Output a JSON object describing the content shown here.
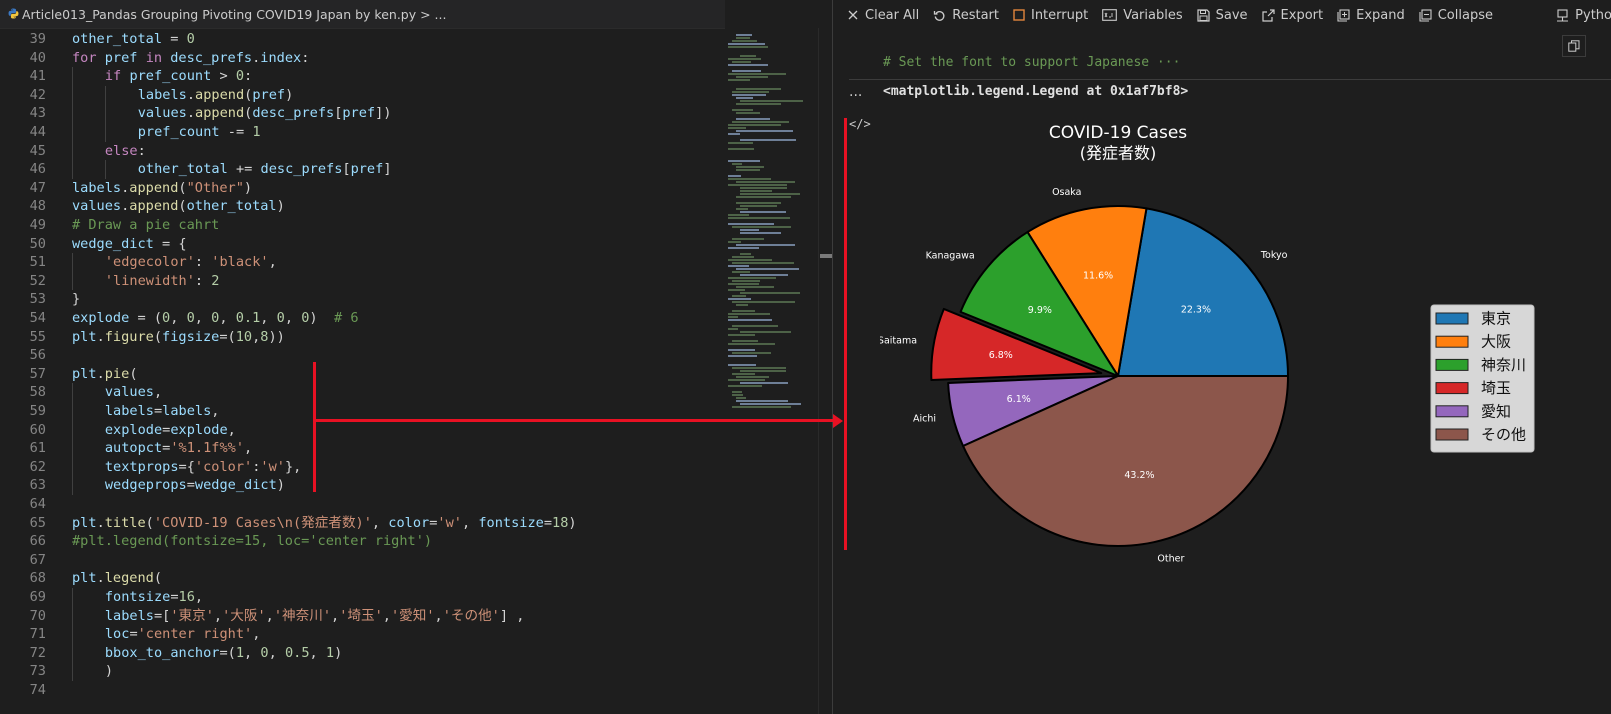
{
  "editor": {
    "tab_title": "Article013_Pandas Grouping Pivoting COVID19 Japan by ken.py > ...",
    "lines": [
      {
        "n": "39",
        "t": [
          [
            "vr",
            "other_total"
          ],
          [
            "op",
            " = "
          ],
          [
            "num",
            "0"
          ]
        ]
      },
      {
        "n": "40",
        "t": [
          [
            "kw",
            "for"
          ],
          [
            "op",
            " "
          ],
          [
            "vr",
            "pref"
          ],
          [
            "op",
            " "
          ],
          [
            "kw",
            "in"
          ],
          [
            "op",
            " "
          ],
          [
            "vr",
            "desc_prefs"
          ],
          [
            "op",
            "."
          ],
          [
            "vr",
            "index"
          ],
          [
            "op",
            ":"
          ]
        ]
      },
      {
        "n": "41",
        "i": 1,
        "t": [
          [
            "kw",
            "if"
          ],
          [
            "op",
            " "
          ],
          [
            "vr",
            "pref_count"
          ],
          [
            "op",
            " > "
          ],
          [
            "num",
            "0"
          ],
          [
            "op",
            ":"
          ]
        ]
      },
      {
        "n": "42",
        "i": 2,
        "t": [
          [
            "vr",
            "labels"
          ],
          [
            "op",
            "."
          ],
          [
            "fn",
            "append"
          ],
          [
            "op",
            "("
          ],
          [
            "vr",
            "pref"
          ],
          [
            "op",
            ")"
          ]
        ]
      },
      {
        "n": "43",
        "i": 2,
        "t": [
          [
            "vr",
            "values"
          ],
          [
            "op",
            "."
          ],
          [
            "fn",
            "append"
          ],
          [
            "op",
            "("
          ],
          [
            "vr",
            "desc_prefs"
          ],
          [
            "op",
            "["
          ],
          [
            "vr",
            "pref"
          ],
          [
            "op",
            "])"
          ]
        ]
      },
      {
        "n": "44",
        "i": 2,
        "t": [
          [
            "vr",
            "pref_count"
          ],
          [
            "op",
            " -= "
          ],
          [
            "num",
            "1"
          ]
        ]
      },
      {
        "n": "45",
        "i": 1,
        "t": [
          [
            "kw",
            "else"
          ],
          [
            "op",
            ":"
          ]
        ]
      },
      {
        "n": "46",
        "i": 2,
        "t": [
          [
            "vr",
            "other_total"
          ],
          [
            "op",
            " += "
          ],
          [
            "vr",
            "desc_prefs"
          ],
          [
            "op",
            "["
          ],
          [
            "vr",
            "pref"
          ],
          [
            "op",
            "]"
          ]
        ]
      },
      {
        "n": "47",
        "t": [
          [
            "vr",
            "labels"
          ],
          [
            "op",
            "."
          ],
          [
            "fn",
            "append"
          ],
          [
            "op",
            "("
          ],
          [
            "str",
            "\"Other\""
          ],
          [
            "op",
            ")"
          ]
        ]
      },
      {
        "n": "48",
        "t": [
          [
            "vr",
            "values"
          ],
          [
            "op",
            "."
          ],
          [
            "fn",
            "append"
          ],
          [
            "op",
            "("
          ],
          [
            "vr",
            "other_total"
          ],
          [
            "op",
            ")"
          ]
        ]
      },
      {
        "n": "49",
        "t": [
          [
            "cm",
            "# Draw a pie cahrt"
          ]
        ]
      },
      {
        "n": "50",
        "t": [
          [
            "vr",
            "wedge_dict"
          ],
          [
            "op",
            " = {"
          ]
        ]
      },
      {
        "n": "51",
        "i": 1,
        "t": [
          [
            "str",
            "'edgecolor'"
          ],
          [
            "op",
            ": "
          ],
          [
            "str",
            "'black'"
          ],
          [
            "op",
            ","
          ]
        ]
      },
      {
        "n": "52",
        "i": 1,
        "t": [
          [
            "str",
            "'linewidth'"
          ],
          [
            "op",
            ": "
          ],
          [
            "num",
            "2"
          ]
        ]
      },
      {
        "n": "53",
        "t": [
          [
            "op",
            "}"
          ]
        ]
      },
      {
        "n": "54",
        "t": [
          [
            "vr",
            "explode"
          ],
          [
            "op",
            " = ("
          ],
          [
            "num",
            "0"
          ],
          [
            "op",
            ", "
          ],
          [
            "num",
            "0"
          ],
          [
            "op",
            ", "
          ],
          [
            "num",
            "0"
          ],
          [
            "op",
            ", "
          ],
          [
            "num",
            "0.1"
          ],
          [
            "op",
            ", "
          ],
          [
            "num",
            "0"
          ],
          [
            "op",
            ", "
          ],
          [
            "num",
            "0"
          ],
          [
            "op",
            ")  "
          ],
          [
            "cm",
            "# 6"
          ]
        ]
      },
      {
        "n": "55",
        "t": [
          [
            "vr",
            "plt"
          ],
          [
            "op",
            "."
          ],
          [
            "fn",
            "figure"
          ],
          [
            "op",
            "("
          ],
          [
            "vr",
            "figsize"
          ],
          [
            "op",
            "=("
          ],
          [
            "num",
            "10"
          ],
          [
            "op",
            ","
          ],
          [
            "num",
            "8"
          ],
          [
            "op",
            "))"
          ]
        ]
      },
      {
        "n": "56",
        "t": []
      },
      {
        "n": "57",
        "t": [
          [
            "vr",
            "plt"
          ],
          [
            "op",
            "."
          ],
          [
            "fn",
            "pie"
          ],
          [
            "op",
            "("
          ]
        ]
      },
      {
        "n": "58",
        "i": 1,
        "t": [
          [
            "vr",
            "values"
          ],
          [
            "op",
            ","
          ]
        ]
      },
      {
        "n": "59",
        "i": 1,
        "t": [
          [
            "vr",
            "labels"
          ],
          [
            "op",
            "="
          ],
          [
            "vr",
            "labels"
          ],
          [
            "op",
            ","
          ]
        ]
      },
      {
        "n": "60",
        "i": 1,
        "t": [
          [
            "vr",
            "explode"
          ],
          [
            "op",
            "="
          ],
          [
            "vr",
            "explode"
          ],
          [
            "op",
            ","
          ]
        ]
      },
      {
        "n": "61",
        "i": 1,
        "t": [
          [
            "vr",
            "autopct"
          ],
          [
            "op",
            "="
          ],
          [
            "str",
            "'%1.1f%%'"
          ],
          [
            "op",
            ","
          ]
        ]
      },
      {
        "n": "62",
        "i": 1,
        "t": [
          [
            "vr",
            "textprops"
          ],
          [
            "op",
            "={"
          ],
          [
            "str",
            "'color'"
          ],
          [
            "op",
            ":"
          ],
          [
            "str",
            "'w'"
          ],
          [
            "op",
            "},"
          ]
        ]
      },
      {
        "n": "63",
        "i": 1,
        "t": [
          [
            "vr",
            "wedgeprops"
          ],
          [
            "op",
            "="
          ],
          [
            "vr",
            "wedge_dict"
          ],
          [
            "op",
            ")"
          ]
        ]
      },
      {
        "n": "64",
        "t": []
      },
      {
        "n": "65",
        "t": [
          [
            "vr",
            "plt"
          ],
          [
            "op",
            "."
          ],
          [
            "fn",
            "title"
          ],
          [
            "op",
            "("
          ],
          [
            "str",
            "'COVID-19 Cases\\n(発症者数)'"
          ],
          [
            "op",
            ", "
          ],
          [
            "vr",
            "color"
          ],
          [
            "op",
            "="
          ],
          [
            "str",
            "'w'"
          ],
          [
            "op",
            ", "
          ],
          [
            "vr",
            "fontsize"
          ],
          [
            "op",
            "="
          ],
          [
            "num",
            "18"
          ],
          [
            "op",
            ")"
          ]
        ]
      },
      {
        "n": "66",
        "t": [
          [
            "cm",
            "#plt.legend(fontsize=15, loc='center right')"
          ]
        ]
      },
      {
        "n": "67",
        "t": []
      },
      {
        "n": "68",
        "t": [
          [
            "vr",
            "plt"
          ],
          [
            "op",
            "."
          ],
          [
            "fn",
            "legend"
          ],
          [
            "op",
            "("
          ]
        ]
      },
      {
        "n": "69",
        "i": 1,
        "t": [
          [
            "vr",
            "fontsize"
          ],
          [
            "op",
            "="
          ],
          [
            "num",
            "16"
          ],
          [
            "op",
            ","
          ]
        ]
      },
      {
        "n": "70",
        "i": 1,
        "t": [
          [
            "vr",
            "labels"
          ],
          [
            "op",
            "=["
          ],
          [
            "str",
            "'東京'"
          ],
          [
            "op",
            ","
          ],
          [
            "str",
            "'大阪'"
          ],
          [
            "op",
            ","
          ],
          [
            "str",
            "'神奈川'"
          ],
          [
            "op",
            ","
          ],
          [
            "str",
            "'埼玉'"
          ],
          [
            "op",
            ","
          ],
          [
            "str",
            "'愛知'"
          ],
          [
            "op",
            ","
          ],
          [
            "str",
            "'その他'"
          ],
          [
            "op",
            "] ,"
          ]
        ]
      },
      {
        "n": "71",
        "i": 1,
        "t": [
          [
            "vr",
            "loc"
          ],
          [
            "op",
            "="
          ],
          [
            "str",
            "'center right'"
          ],
          [
            "op",
            ","
          ]
        ]
      },
      {
        "n": "72",
        "i": 1,
        "t": [
          [
            "vr",
            "bbox_to_anchor"
          ],
          [
            "op",
            "=("
          ],
          [
            "num",
            "1"
          ],
          [
            "op",
            ", "
          ],
          [
            "num",
            "0"
          ],
          [
            "op",
            ", "
          ],
          [
            "num",
            "0.5"
          ],
          [
            "op",
            ", "
          ],
          [
            "num",
            "1"
          ],
          [
            "op",
            ")"
          ]
        ]
      },
      {
        "n": "73",
        "i": 1,
        "t": [
          [
            "op",
            ")"
          ]
        ]
      },
      {
        "n": "74",
        "t": []
      }
    ]
  },
  "toolbar": {
    "clear_all": "Clear All",
    "restart": "Restart",
    "interrupt": "Interrupt",
    "variables": "Variables",
    "save": "Save",
    "export": "Export",
    "expand": "Expand",
    "collapse": "Collapse",
    "python": "Pytho"
  },
  "cell": {
    "comment": "# Set the font to support Japanese ···",
    "ellipsis": "...",
    "output_text": "<matplotlib.legend.Legend at 0x1af7bf8>",
    "code_icon": "</>"
  },
  "colors": {
    "accent_red": "#e81123",
    "tokyo": "#1f77b4",
    "osaka": "#ff7f0e",
    "kanagawa": "#2ca02c",
    "saitama": "#d62728",
    "aichi": "#9467bd",
    "other": "#8c564b"
  },
  "chart_data": {
    "type": "pie",
    "title": "COVID-19 Cases",
    "subtitle": "(発症者数)",
    "categories": [
      "Tokyo",
      "Osaka",
      "Kanagawa",
      "Saitama",
      "Aichi",
      "Other"
    ],
    "values": [
      22.3,
      11.6,
      9.9,
      6.8,
      6.1,
      43.2
    ],
    "value_labels": [
      "22.3%",
      "11.6%",
      "9.9%",
      "6.8%",
      "6.1%",
      "43.2%"
    ],
    "explode": [
      0,
      0,
      0,
      0.1,
      0,
      0
    ],
    "start_angle_deg": 0,
    "direction": "counterclockwise",
    "legend_labels": [
      "東京",
      "大阪",
      "神奈川",
      "埼玉",
      "愛知",
      "その他"
    ],
    "legend_position": "center-right"
  }
}
